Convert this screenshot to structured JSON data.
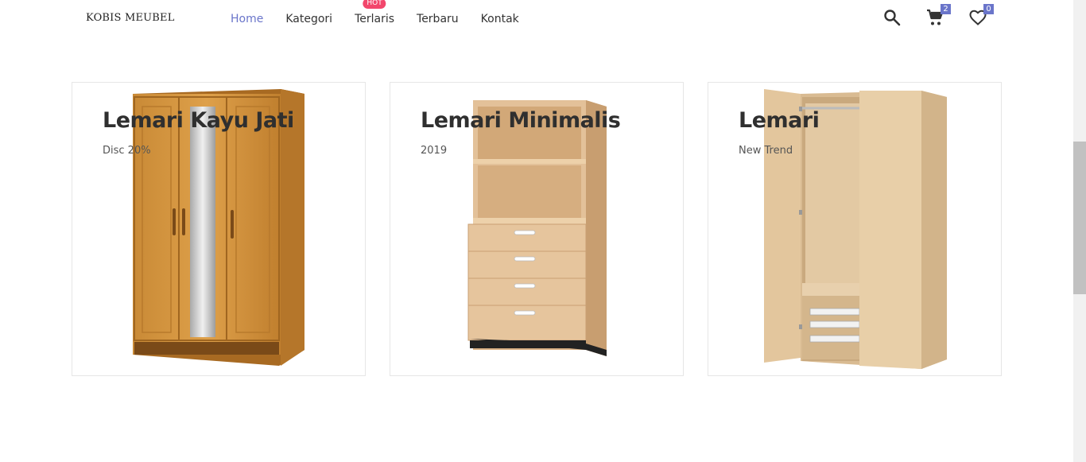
{
  "header": {
    "logo": "KOBIS MEUBEL",
    "nav": [
      {
        "label": "Home",
        "active": true
      },
      {
        "label": "Kategori"
      },
      {
        "label": "Terlaris",
        "badge": "HOT"
      },
      {
        "label": "Terbaru"
      },
      {
        "label": "Kontak"
      }
    ],
    "cart_count": "2",
    "wishlist_count": "0",
    "icons": [
      "search-icon",
      "cart-icon",
      "heart-icon"
    ]
  },
  "cards": [
    {
      "title": "Lemari Kayu Jati",
      "subtitle": "Disc 20%",
      "image": "wardrobe-mirror"
    },
    {
      "title": "Lemari Minimalis",
      "subtitle": "2019",
      "image": "shelf-drawers"
    },
    {
      "title": "Lemari",
      "subtitle": "New Trend",
      "image": "wardrobe-open"
    }
  ],
  "colors": {
    "accent": "#6a75ca",
    "hot": "#f2476c"
  }
}
